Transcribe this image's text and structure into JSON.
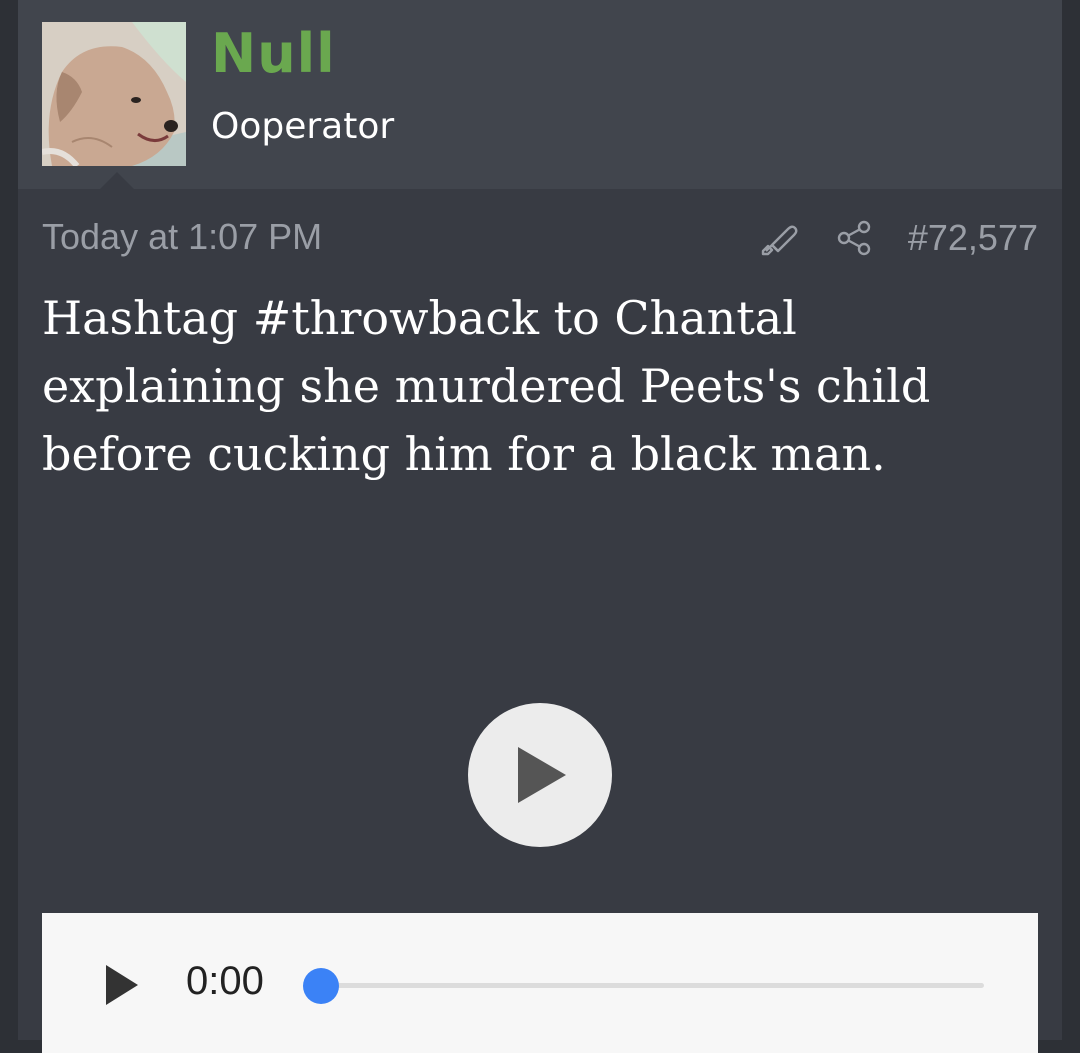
{
  "user": {
    "name": "Null",
    "title": "Ooperator",
    "name_color": "#6aa84f"
  },
  "post": {
    "date": "Today at 1:07 PM",
    "number": "#72,577",
    "message": "Hashtag #throwback to Chantal explaining she murdered Peets's child before cucking him for a black man."
  },
  "icons": {
    "edit": "highlighter-icon",
    "share": "share-icon",
    "play": "play-icon"
  },
  "media": {
    "video_progress": 0
  },
  "audio": {
    "time": "0:00",
    "progress": 0,
    "thumb_color": "#3b82f6"
  }
}
